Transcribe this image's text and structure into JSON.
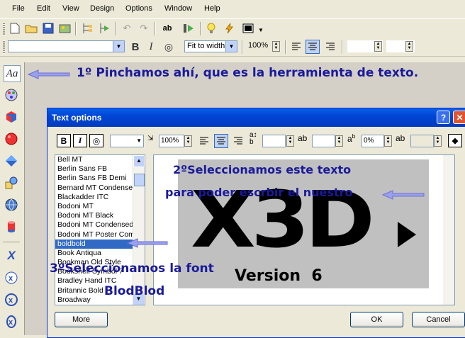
{
  "menu": [
    "File",
    "Edit",
    "View",
    "Design",
    "Options",
    "Window",
    "Help"
  ],
  "toolbar2": {
    "zoom_value": "100%",
    "fit_value": "Fit to width"
  },
  "dialog": {
    "title": "Text options",
    "scale_value": "100%",
    "percent_value": "0%",
    "fonts": [
      "Bell MT",
      "Berlin Sans FB",
      "Berlin Sans FB Demi",
      "Bernard MT Condense",
      "Blackadder ITC",
      "Bodoni MT",
      "Bodoni MT Black",
      "Bodoni MT Condensed",
      "Bodoni MT Poster Com",
      "boldbold",
      "Book Antiqua",
      "Bookman Old Style",
      "Bookshelf Symbol 7",
      "Bradley Hand ITC",
      "Britannic Bold",
      "Broadway"
    ],
    "selected_font": "boldbold",
    "preview_main": "X3D",
    "preview_sub": "Version  6",
    "buttons": {
      "more": "More",
      "ok": "OK",
      "cancel": "Cancel"
    }
  },
  "annotations": {
    "step1": "1º Pinchamos ahí, que es la herramienta de texto.",
    "step2_line1": "2ºSeleccionamos este texto",
    "step2_line2": "para poder escrbir el nuestro",
    "step3_line1": "3ºSeleccionamos la font",
    "step3_line2": "BlodBlod"
  },
  "colors": {
    "annotation": "#1a1a9a",
    "title_bar": "#0046d5",
    "selection": "#316ac5"
  }
}
